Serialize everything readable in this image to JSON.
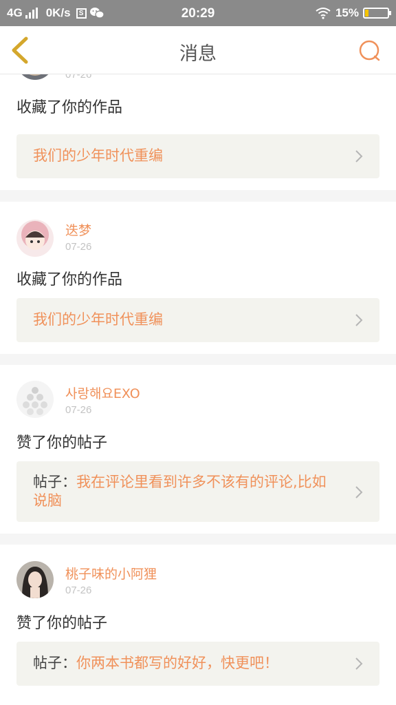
{
  "status_bar": {
    "network": "4G",
    "speed": "0K/s",
    "time": "20:29",
    "battery": "15%",
    "battery_level": 0.15,
    "icons": [
      "signal-icon",
      "s-app-icon",
      "wechat-icon",
      "wifi-icon",
      "battery-icon"
    ]
  },
  "nav": {
    "title": "消息",
    "back_icon": "chevron-left-icon",
    "chat_icon": "chat-bubble-icon",
    "accent_color": "#f0915a",
    "back_color": "#d4a72c"
  },
  "messages": [
    {
      "username": "",
      "date": "07-26",
      "action": "收藏了你的作品",
      "ref_prefix": "",
      "ref_title": "我们的少年时代重编"
    },
    {
      "username": "迭梦",
      "date": "07-26",
      "action": "收藏了你的作品",
      "ref_prefix": "",
      "ref_title": "我们的少年时代重编"
    },
    {
      "username": "사랑해요EXO",
      "date": "07-26",
      "action": "赞了你的帖子",
      "ref_prefix": "帖子：",
      "ref_title": "我在评论里看到许多不该有的评论,比如说脑"
    },
    {
      "username": "桃子味的小阿狸",
      "date": "07-26",
      "action": "赞了你的帖子",
      "ref_prefix": "帖子：",
      "ref_title": "你两本书都写的好好，快更吧！"
    }
  ]
}
